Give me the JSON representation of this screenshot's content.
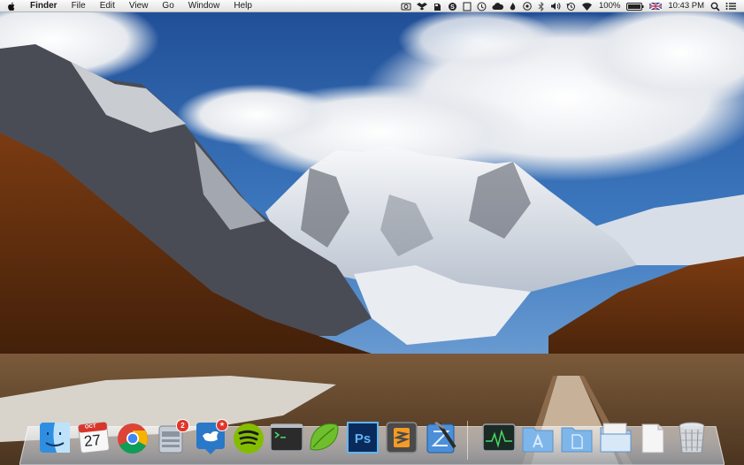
{
  "menubar": {
    "app_name": "Finder",
    "menus": [
      "File",
      "Edit",
      "View",
      "Go",
      "Window",
      "Help"
    ],
    "battery_percent": "100%",
    "time": "10:43 PM"
  },
  "status_icons": [
    "camera-icon",
    "dropbox-icon",
    "evernote-icon",
    "skype-icon",
    "file-icon",
    "clock-icon",
    "cloud-icon",
    "fire-icon",
    "eye-icon",
    "bluetooth-icon",
    "volume-icon",
    "history-icon",
    "wifi-icon",
    "battery-icon",
    "flag-icon",
    "search-icon",
    "notification-list-icon"
  ],
  "calendar": {
    "month": "OCT",
    "day": "27"
  },
  "badges": {
    "mail": "2",
    "tweetbot": "★"
  },
  "dock_apps": [
    {
      "name": "Finder"
    },
    {
      "name": "Calendar"
    },
    {
      "name": "Google Chrome"
    },
    {
      "name": "Mail"
    },
    {
      "name": "Tweetbot"
    },
    {
      "name": "Spotify"
    },
    {
      "name": "Terminal"
    },
    {
      "name": "Evernote"
    },
    {
      "name": "Photoshop"
    },
    {
      "name": "Sublime Text"
    },
    {
      "name": "Xcode"
    }
  ],
  "dock_stacks": [
    {
      "name": "Activity Monitor"
    },
    {
      "name": "Applications"
    },
    {
      "name": "Documents"
    },
    {
      "name": "Downloads"
    },
    {
      "name": "Document"
    },
    {
      "name": "Trash"
    }
  ],
  "colors": {
    "menubar": "#ededed",
    "sky": "#2c5ea6",
    "photoshop": "#0a2a5c",
    "tweetbot": "#2a78c8",
    "spotify": "#84bd00"
  }
}
